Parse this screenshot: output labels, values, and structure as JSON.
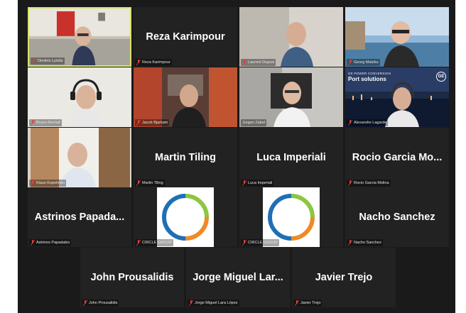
{
  "meeting": {
    "colors": {
      "background": "#1a1a1a",
      "tile": "#222222",
      "active_speaker_border": "#d8e26a",
      "muted_mic": "#e0433d",
      "logo_orange": "#f08a24",
      "logo_green": "#8dc63f",
      "logo_blue": "#1f6fb5"
    },
    "participants": [
      {
        "label": "Dimitris Lyridis",
        "video": true,
        "active_speaker": true,
        "muted": true
      },
      {
        "label": "Reza Karimpour",
        "display_name": "Reza Karimpour",
        "video": false,
        "muted": true
      },
      {
        "label": "Laurent Dupuis",
        "video": true,
        "muted": true
      },
      {
        "label": "Georg Matzku",
        "video": true,
        "muted": true
      },
      {
        "label": "Bruno Rechaf",
        "video": true,
        "muted": true
      },
      {
        "label": "Jacob Bjarkam",
        "video": true,
        "muted": true
      },
      {
        "label": "Jurgen Zabel",
        "video": true,
        "muted": false
      },
      {
        "label": "Alexandre Lagarde",
        "video": true,
        "muted": true,
        "banner_small": "GE POWER CONVERSION",
        "banner_big": "Port solutions",
        "banner_icon": "GE"
      },
      {
        "label": "Klaus Kopelman",
        "video": true,
        "muted": true
      },
      {
        "label": "Martin Tiling",
        "display_name": "Martin Tiling",
        "video": false,
        "muted": true
      },
      {
        "label": "Luca Imperiali",
        "display_name": "Luca Imperiali",
        "video": false,
        "muted": true
      },
      {
        "label": "Rocio Garcia Molina",
        "display_name": "Rocio Garcia Mo...",
        "video": false,
        "muted": true
      },
      {
        "label": "Astrinos Papadakis",
        "display_name": "Astrinos Papada...",
        "video": false,
        "muted": true
      },
      {
        "label": "CIRCLE GROUP",
        "logo": true,
        "muted": true
      },
      {
        "label": "CIRCLE GROUP",
        "logo": true,
        "muted": true
      },
      {
        "label": "Nacho Sanchez",
        "display_name": "Nacho Sanchez",
        "video": false,
        "muted": true
      },
      {
        "label": "John Prousalidis",
        "display_name": "John Prousalidis",
        "video": false,
        "muted": true
      },
      {
        "label": "Jorge Miguel Lara López",
        "display_name": "Jorge Miguel Lar...",
        "video": false,
        "muted": true
      },
      {
        "label": "Javier Trejo",
        "display_name": "Javier Trejo",
        "video": false,
        "muted": true
      }
    ]
  }
}
